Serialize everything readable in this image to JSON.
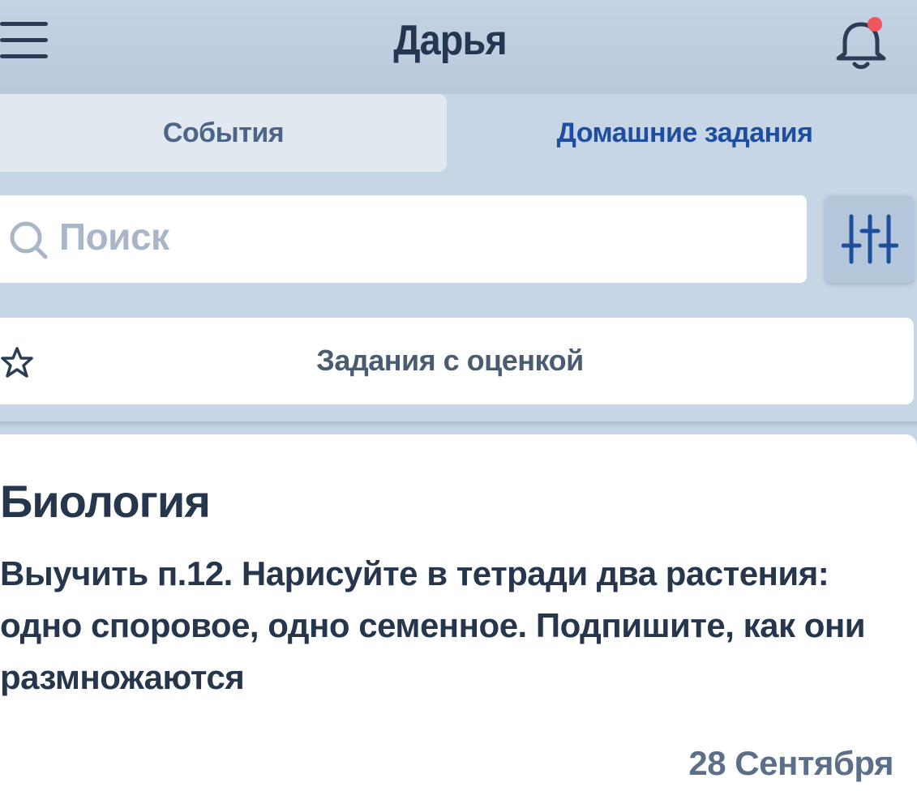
{
  "header": {
    "title": "Дарья",
    "notification_badge_color": "#f0565e",
    "icons": [
      "menu-icon",
      "bell-icon"
    ]
  },
  "tabs": [
    {
      "label": "События",
      "active": false
    },
    {
      "label": "Домашние задания",
      "active": true
    }
  ],
  "search": {
    "placeholder": "Поиск",
    "value": ""
  },
  "filters": {
    "graded_label": "Задания с оценкой",
    "graded_starred": false
  },
  "homework": [
    {
      "subject": "Биология",
      "text": "Выучить п.12. Нарисуйте в тетради два растения: одно споровое, одно семенное. Подпишите, как они размножаются",
      "date": "28 Сентября"
    }
  ],
  "colors": {
    "background": "#c7d6e6",
    "accent": "#1f4e9f",
    "text_dark": "#25364d"
  }
}
